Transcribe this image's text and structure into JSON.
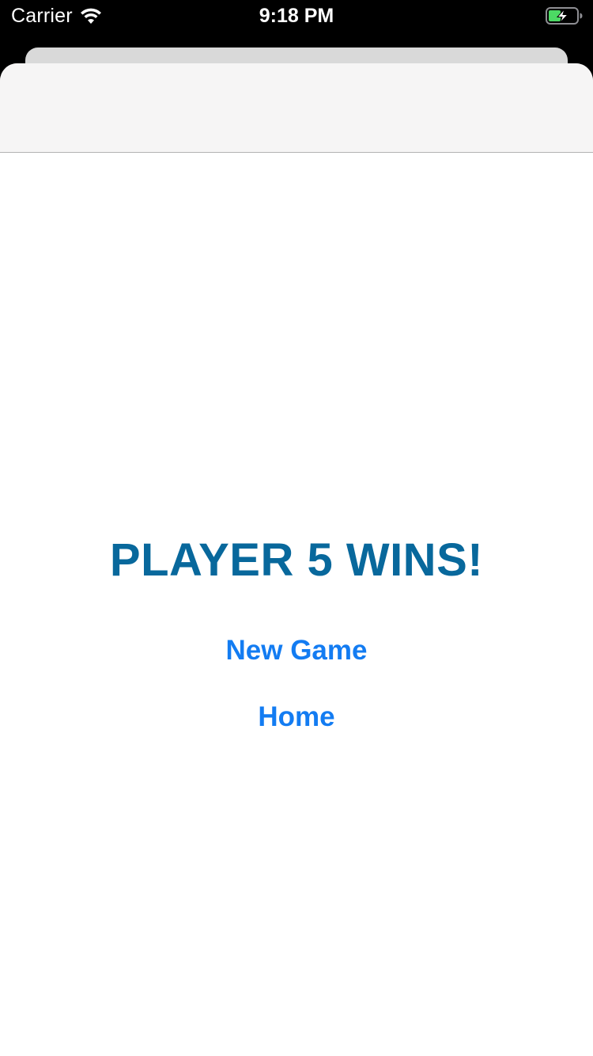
{
  "status_bar": {
    "carrier": "Carrier",
    "time": "9:18 PM",
    "wifi_icon": "wifi-icon",
    "battery_icon": "battery-charging-icon"
  },
  "game_over": {
    "result": "PLAYER 5 WINS!",
    "new_game_label": "New Game",
    "home_label": "Home"
  },
  "colors": {
    "result_text": "#08689c",
    "link_text": "#137cf2",
    "nav_bar_bg": "#f6f5f5",
    "battery_fill": "#4cd964"
  }
}
